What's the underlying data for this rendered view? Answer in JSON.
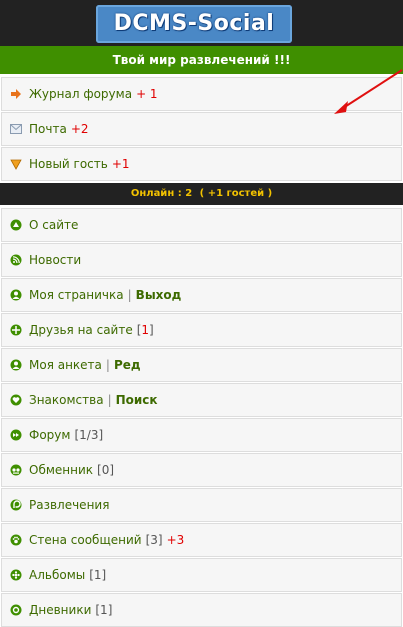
{
  "logo": {
    "text": "DCMS-Social"
  },
  "tagline": "Твой мир развлечений !!!",
  "top_items": [
    {
      "icon": "arrow-right-icon",
      "label": "Журнал форума",
      "badge": "+ 1"
    },
    {
      "icon": "envelope-icon",
      "label": "Почта",
      "badge": "+2"
    },
    {
      "icon": "guest-icon",
      "label": "Новый гость",
      "badge": "+1"
    }
  ],
  "online": {
    "text": "Онлайн : 2",
    "guests": "( +1 гостей )"
  },
  "menu": {
    "about": "О сайте",
    "news": "Новости",
    "my_page": "Моя страничка",
    "logout": "Выход",
    "friends": "Друзья на сайте",
    "friends_count": "[1]",
    "profile": "Моя анкета",
    "edit": "Ред",
    "dating": "Знакомства",
    "search": "Поиск",
    "forum": "Форум",
    "forum_count": "[1/3]",
    "exchange": "Обменник",
    "exchange_count": "[0]",
    "entertainment": "Развлечения",
    "wall": "Стена сообщений",
    "wall_count": "[3]",
    "wall_new": "+3",
    "albums": "Альбомы",
    "albums_count": "[1]",
    "diaries": "Дневники",
    "diaries_count": "[1]"
  },
  "colors": {
    "green": "#3f8f00",
    "dark": "#222222",
    "link": "#3d6a00",
    "badge": "#e00000",
    "online": "#f2c200"
  }
}
